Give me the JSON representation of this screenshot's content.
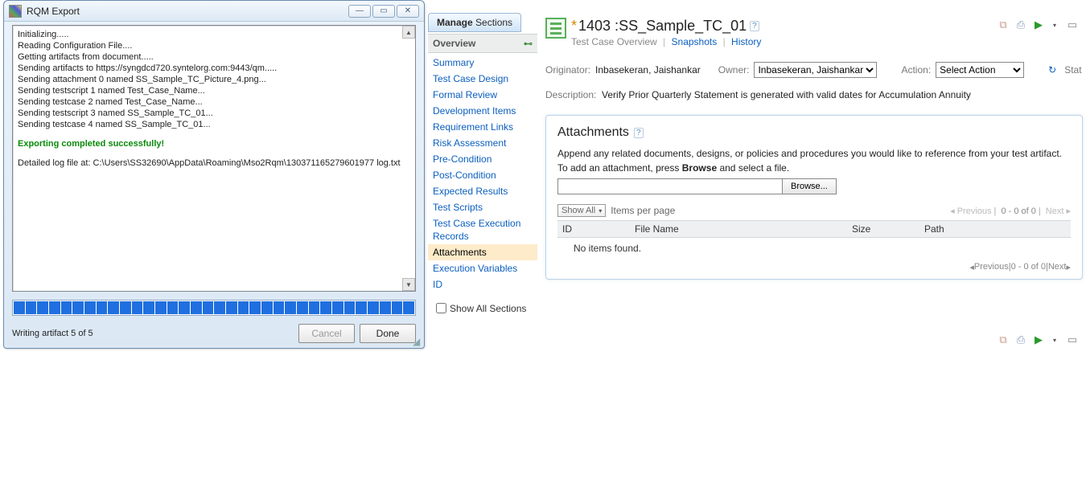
{
  "dialog": {
    "title": "RQM Export",
    "log": [
      "Initializing.....",
      "Reading Configuration File....",
      "Getting artifacts from document.....",
      "Sending artifacts to https://syngdcd720.syntelorg.com:9443/qm.....",
      "Sending attachment 0 named SS_Sample_TC_Picture_4.png...",
      "Sending testscript 1 named Test_Case_Name...",
      "Sending testcase 2 named Test_Case_Name...",
      "Sending testscript 3 named SS_Sample_TC_01...",
      "Sending testcase 4 named SS_Sample_TC_01..."
    ],
    "success": "Exporting completed successfully!",
    "logpath": "Detailed log file at: C:\\Users\\SS32690\\AppData\\Roaming\\Mso2Rqm\\130371165279601977 log.txt",
    "status": "Writing artifact 5 of 5",
    "cancel": "Cancel",
    "done": "Done"
  },
  "sections": {
    "tab": {
      "boldPart": "Manage",
      "rest": " Sections"
    },
    "header": "Overview",
    "items": [
      "Summary",
      "Test Case Design",
      "Formal Review",
      "Development Items",
      "Requirement Links",
      "Risk Assessment",
      "Pre-Condition",
      "Post-Condition",
      "Expected Results",
      "Test Scripts",
      "Test Case Execution Records",
      "Attachments",
      "Execution Variables",
      "ID"
    ],
    "activeIndex": 11,
    "showAll": "Show All Sections"
  },
  "tc": {
    "title_id": "1403 :",
    "title_name": "  SS_Sample_TC_01",
    "subnav": {
      "overview": "Test Case Overview",
      "snapshots": "Snapshots",
      "history": "History"
    },
    "meta": {
      "originator_label": "Originator:",
      "originator_value": "Inbasekeran, Jaishankar",
      "owner_label": "Owner:",
      "owner_value": "Inbasekeran, Jaishankar",
      "action_label": "Action:",
      "action_value": "Select Action",
      "stat_label": "Stat"
    },
    "desc": {
      "label": "Description:",
      "value": "Verify  Prior Quarterly Statement is generated with valid dates for Accumulation Annuity"
    },
    "panel": {
      "title": "Attachments",
      "line1": "Append any related documents, designs, or policies and procedures you would like to reference from your test artifact.",
      "line2a": "To add an attachment, press ",
      "line2b": "Browse",
      "line2c": " and select a file.",
      "browse": "Browse...",
      "show_all": "Show All",
      "per_page": "Items per page",
      "pager": {
        "prev": "Previous",
        "range": "0 - 0 of 0",
        "next": "Next"
      },
      "cols": {
        "id": "ID",
        "file": "File Name",
        "size": "Size",
        "path": "Path"
      },
      "empty": "No items found."
    }
  }
}
